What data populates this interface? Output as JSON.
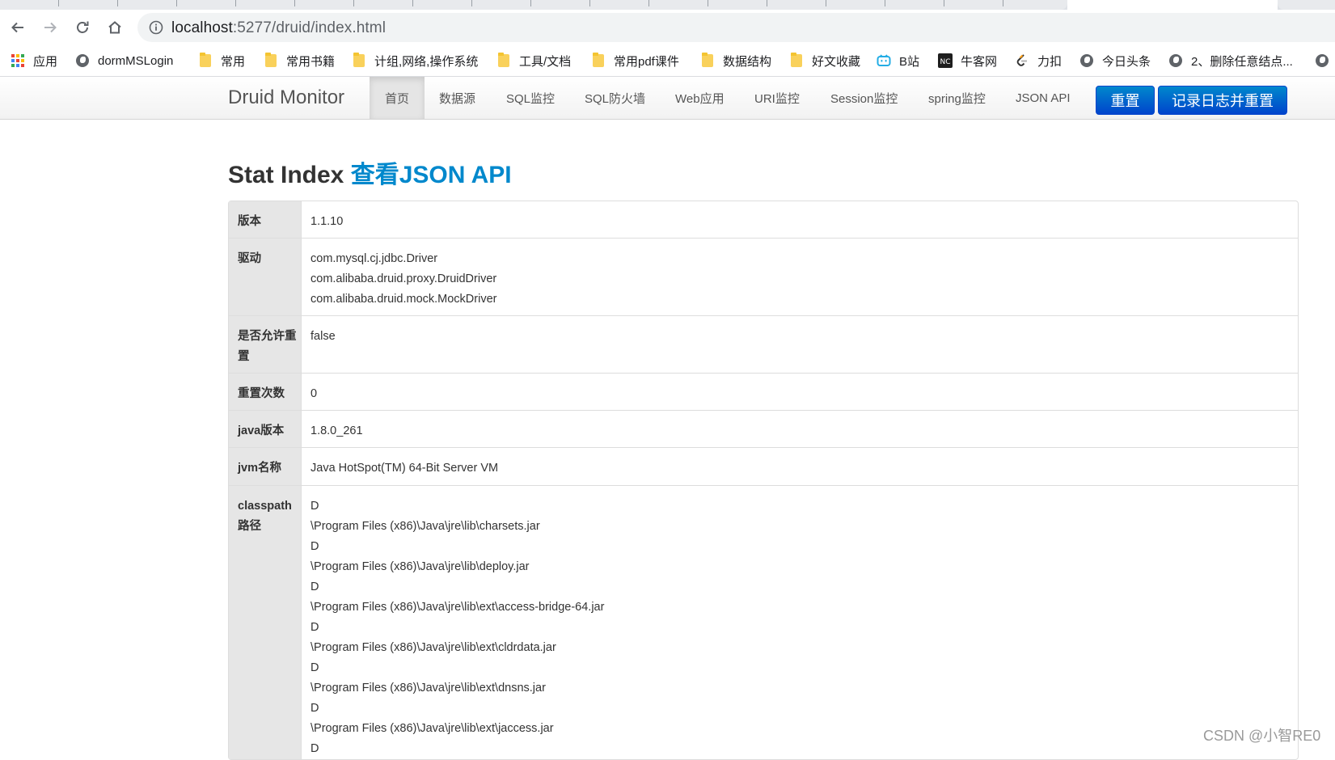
{
  "browser": {
    "url_host": "localhost",
    "url_rest": ":5277/druid/index.html",
    "bookmarks": [
      {
        "label": "应用",
        "icon": "apps-grid-icon"
      },
      {
        "label": "dormMSLogin",
        "icon": "globe-icon"
      },
      {
        "label": "常用",
        "icon": "folder-icon"
      },
      {
        "label": "常用书籍",
        "icon": "folder-icon"
      },
      {
        "label": "计组,网络,操作系统",
        "icon": "folder-icon"
      },
      {
        "label": "工具/文档",
        "icon": "folder-icon"
      },
      {
        "label": "常用pdf课件",
        "icon": "folder-icon"
      },
      {
        "label": "数据结构",
        "icon": "folder-icon"
      },
      {
        "label": "好文收藏",
        "icon": "folder-icon"
      },
      {
        "label": "B站",
        "icon": "bilibili-icon"
      },
      {
        "label": "牛客网",
        "icon": "nowcoder-icon"
      },
      {
        "label": "力扣",
        "icon": "leetcode-icon"
      },
      {
        "label": "今日头条",
        "icon": "globe-icon"
      },
      {
        "label": "2、删除任意结点...",
        "icon": "globe-icon"
      }
    ]
  },
  "druid": {
    "brand": "Druid Monitor",
    "nav": [
      "首页",
      "数据源",
      "SQL监控",
      "SQL防火墙",
      "Web应用",
      "URI监控",
      "Session监控",
      "spring监控",
      "JSON API"
    ],
    "reset_button": "重置",
    "log_reset_button": "记录日志并重置",
    "heading": "Stat Index",
    "heading_link": "查看JSON API",
    "rows": [
      {
        "label": "版本",
        "lines": [
          "1.1.10"
        ]
      },
      {
        "label": "驱动",
        "lines": [
          "com.mysql.cj.jdbc.Driver",
          "com.alibaba.druid.proxy.DruidDriver",
          "com.alibaba.druid.mock.MockDriver"
        ]
      },
      {
        "label": "是否允许重置",
        "lines": [
          "false"
        ]
      },
      {
        "label": "重置次数",
        "lines": [
          "0"
        ]
      },
      {
        "label": "java版本",
        "lines": [
          "1.8.0_261"
        ]
      },
      {
        "label": "jvm名称",
        "lines": [
          "Java HotSpot(TM) 64-Bit Server VM"
        ]
      },
      {
        "label": "classpath路径",
        "lines": [
          "D",
          "\\Program Files (x86)\\Java\\jre\\lib\\charsets.jar",
          "D",
          "\\Program Files (x86)\\Java\\jre\\lib\\deploy.jar",
          "D",
          "\\Program Files (x86)\\Java\\jre\\lib\\ext\\access-bridge-64.jar",
          "D",
          "\\Program Files (x86)\\Java\\jre\\lib\\ext\\cldrdata.jar",
          "D",
          "\\Program Files (x86)\\Java\\jre\\lib\\ext\\dnsns.jar",
          "D",
          "\\Program Files (x86)\\Java\\jre\\lib\\ext\\jaccess.jar",
          "D"
        ]
      }
    ]
  },
  "watermark": "CSDN @小智RE0",
  "colors": {
    "link": "#0088cc",
    "primary_top": "#0088cc",
    "primary_bottom": "#0044cc"
  }
}
